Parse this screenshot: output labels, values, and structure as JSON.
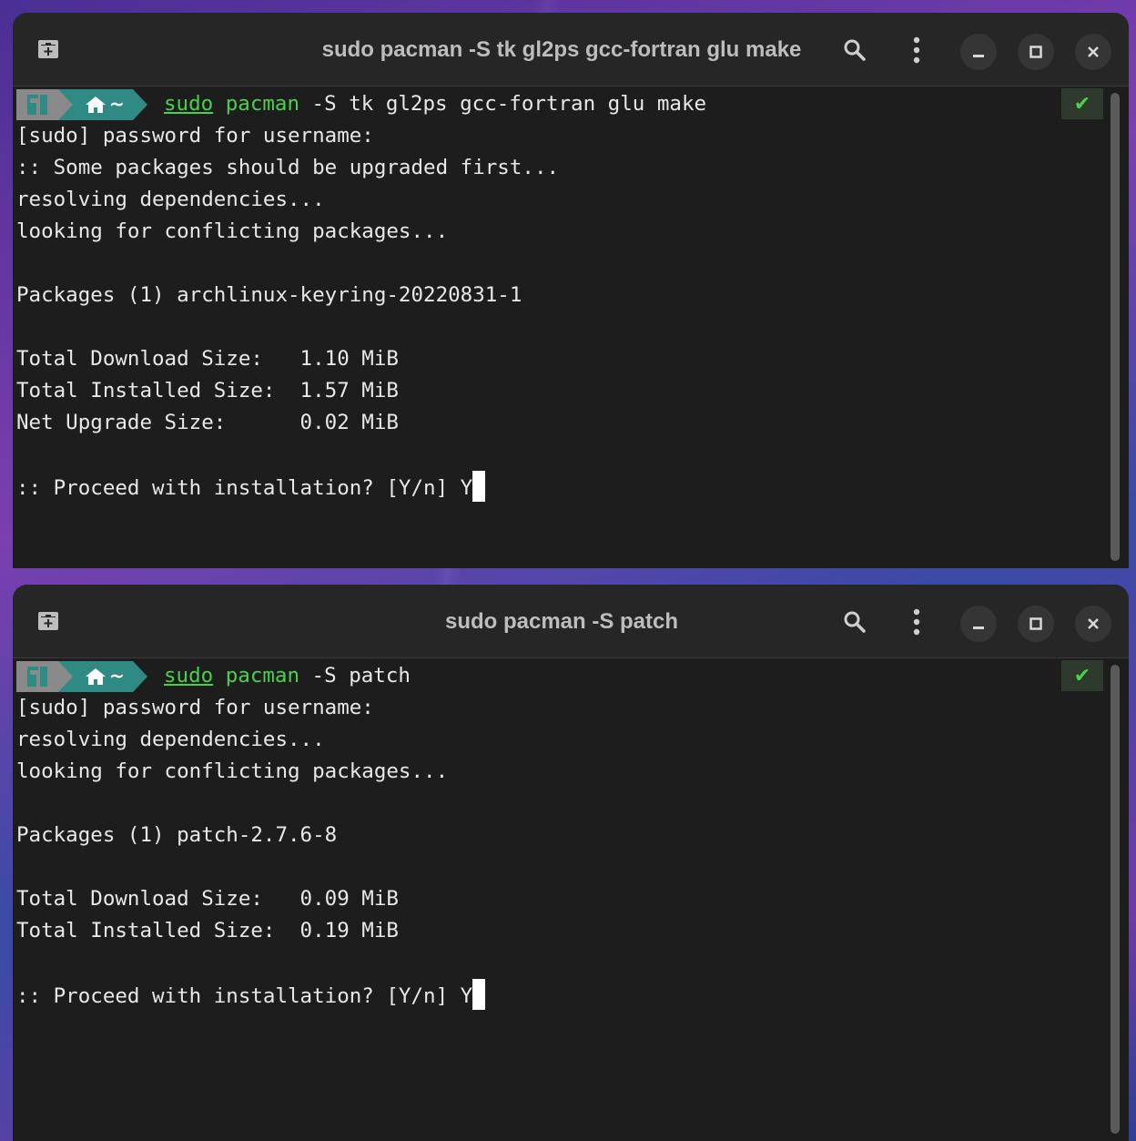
{
  "terminals": [
    {
      "title": "sudo pacman -S tk gl2ps gcc-fortran glu make",
      "prompt": {
        "home": "~",
        "sudo": "sudo",
        "pacman": "pacman",
        "args": " -S tk gl2ps gcc-fortran glu make"
      },
      "status": "✔",
      "lines": [
        "[sudo] password for username:",
        ":: Some packages should be upgraded first...",
        "resolving dependencies...",
        "looking for conflicting packages...",
        "",
        "Packages (1) archlinux-keyring-20220831-1",
        "",
        "Total Download Size:   1.10 MiB",
        "Total Installed Size:  1.57 MiB",
        "Net Upgrade Size:      0.02 MiB",
        ""
      ],
      "final_line": ":: Proceed with installation? [Y/n] Y"
    },
    {
      "title": "sudo pacman -S patch",
      "prompt": {
        "home": "~",
        "sudo": "sudo",
        "pacman": "pacman",
        "args": " -S patch"
      },
      "status": "✔",
      "lines": [
        "[sudo] password for username:",
        "resolving dependencies...",
        "looking for conflicting packages...",
        "",
        "Packages (1) patch-2.7.6-8",
        "",
        "Total Download Size:   0.09 MiB",
        "Total Installed Size:  0.19 MiB",
        ""
      ],
      "final_line": ":: Proceed with installation? [Y/n] Y"
    }
  ],
  "icons": {
    "new_tab": "new-tab-icon",
    "search": "search-icon",
    "menu": "kebab-menu-icon",
    "minimize": "minimize-icon",
    "maximize": "maximize-icon",
    "close": "close-icon",
    "distro": "manjaro-logo-icon",
    "home": "home-icon"
  },
  "colors": {
    "terminal_bg": "#1d1d1d",
    "titlebar_bg": "#262626",
    "command_green": "#4bd04b",
    "prompt_gray": "#8a8a8a",
    "prompt_teal": "#2f8a84"
  }
}
